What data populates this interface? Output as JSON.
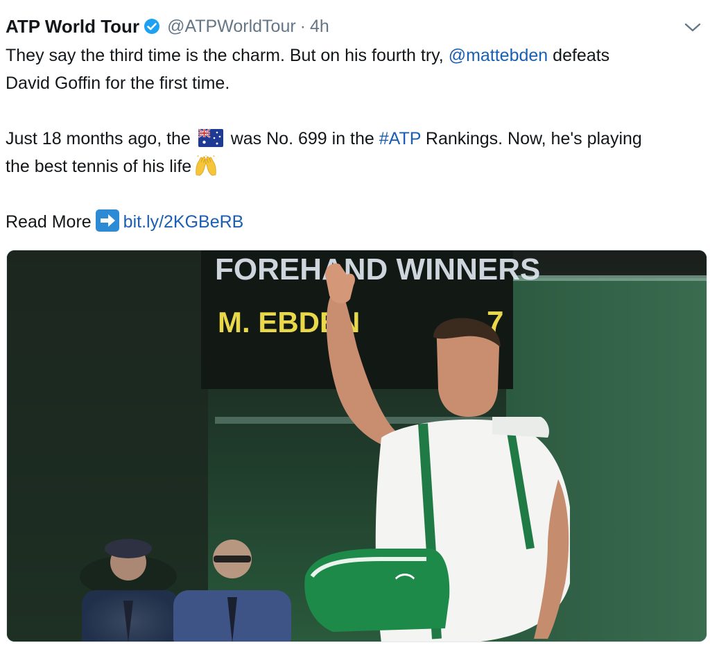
{
  "tweet": {
    "display_name": "ATP World Tour",
    "handle": "@ATPWorldTour",
    "separator": "·",
    "time": "4h",
    "line1_pre": "They say the third time is the charm. But on his fourth try, ",
    "mention": "@mattebden",
    "line1_post": " defeats",
    "line2": "David Goffin for the first time.",
    "line3_pre": "Just 18 months ago, the ",
    "line3_mid": " was No. 699 in the ",
    "hashtag": "#ATP",
    "line3_post": " Rankings. Now, he's playing",
    "line4": "the best tennis of his life",
    "read_more": "Read More",
    "link": "bit.ly/2KGBeRB"
  },
  "media": {
    "scoreboard_heading": "FOREHAND WINNERS",
    "scoreboard_name": "M. EBDEN",
    "scoreboard_value": "7"
  },
  "icons": {
    "verified": "verified-badge-icon",
    "caret": "chevron-down-icon",
    "flag": "australia-flag-emoji",
    "hands": "raising-hands-emoji",
    "arrow": "right-arrow-emoji"
  },
  "colors": {
    "link": "#1b5fb5",
    "verified": "#1da1f2",
    "muted": "#657786",
    "scoreboard_text": "#e8d84a"
  }
}
